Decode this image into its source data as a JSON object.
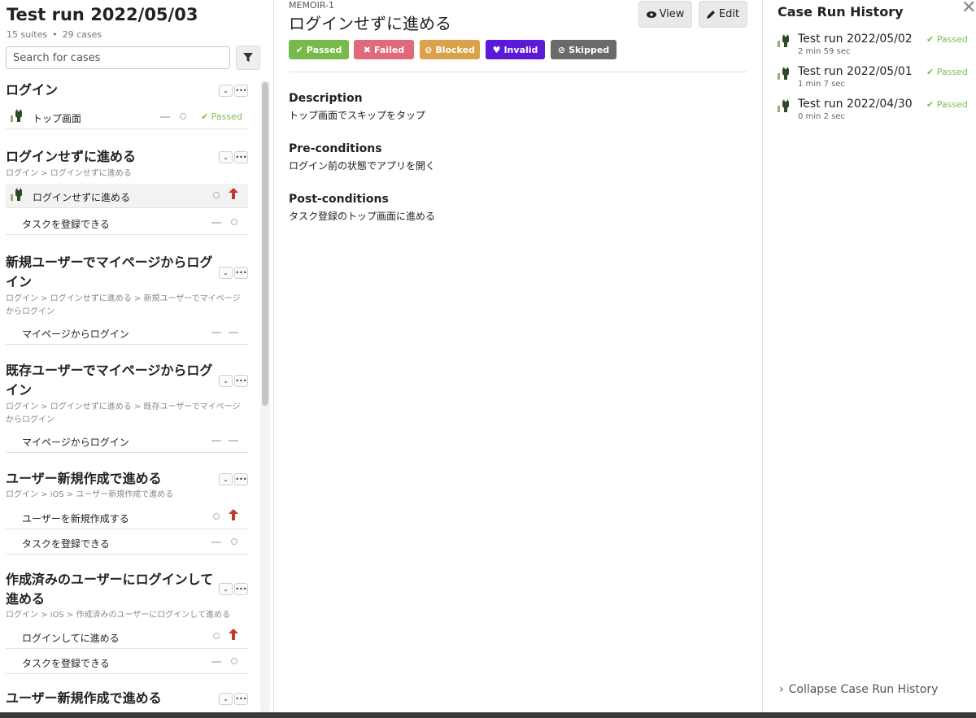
{
  "run": {
    "title": "Test run 2022/05/03",
    "suites": "15 suites",
    "cases": "29 cases"
  },
  "search": {
    "placeholder": "Search for cases"
  },
  "suites": [
    {
      "title": "ログイン",
      "path": "",
      "cases": [
        {
          "label": "トップ画面",
          "status": "Passed"
        }
      ]
    },
    {
      "title": "ログインせずに進める",
      "path": "ログイン > ログインせずに進める",
      "cases": [
        {
          "label": "ログインせずに進める"
        },
        {
          "label": "タスクを登録できる"
        }
      ]
    },
    {
      "title": "新規ユーザーでマイページからログイン",
      "path": "ログイン > ログインせずに進める > 新規ユーザーでマイページからログイン",
      "cases": [
        {
          "label": "マイページからログイン"
        }
      ]
    },
    {
      "title": "既存ユーザーでマイページからログイン",
      "path": "ログイン > ログインせずに進める > 既存ユーザーでマイページからログイン",
      "cases": [
        {
          "label": "マイページからログイン"
        }
      ]
    },
    {
      "title": "ユーザー新規作成で進める",
      "path": "ログイン > iOS > ユーザー新規作成で進める",
      "cases": [
        {
          "label": "ユーザーを新規作成する"
        },
        {
          "label": "タスクを登録できる"
        }
      ]
    },
    {
      "title": "作成済みのユーザーにログインして進める",
      "path": "ログイン > iOS > 作成済みのユーザーにログインして進める",
      "cases": [
        {
          "label": "ログインしてに進める"
        },
        {
          "label": "タスクを登録できる"
        }
      ]
    },
    {
      "title": "ユーザー新規作成で進める",
      "path": "",
      "cases": []
    }
  ],
  "detail": {
    "key": "MEMOIR-1",
    "title": "ログインせずに進める",
    "view_label": "View",
    "edit_label": "Edit",
    "statuses": [
      {
        "label": "Passed",
        "color": "#77b94a"
      },
      {
        "label": "Failed",
        "color": "#e0697a"
      },
      {
        "label": "Blocked",
        "color": "#dba24c"
      },
      {
        "label": "Invalid",
        "color": "#5b19d8"
      },
      {
        "label": "Skipped",
        "color": "#6a6a6a"
      }
    ],
    "description_heading": "Description",
    "description": "トップ画面でスキップをタップ",
    "preconditions_heading": "Pre-conditions",
    "preconditions": "ログイン前の状態でアプリを開く",
    "postconditions_heading": "Post-conditions",
    "postconditions": "タスク登録のトップ画面に進める"
  },
  "history": {
    "title": "Case Run History",
    "items": [
      {
        "name": "Test run 2022/05/02",
        "duration": "2 min 59 sec",
        "status": "Passed"
      },
      {
        "name": "Test run 2022/05/01",
        "duration": "1 min 7 sec",
        "status": "Passed"
      },
      {
        "name": "Test run 2022/04/30",
        "duration": "0 min 2 sec",
        "status": "Passed"
      }
    ],
    "collapse_label": "Collapse Case Run History"
  },
  "colors": {
    "passed": "#7bbf50",
    "arrow_red": "#c0392b"
  }
}
